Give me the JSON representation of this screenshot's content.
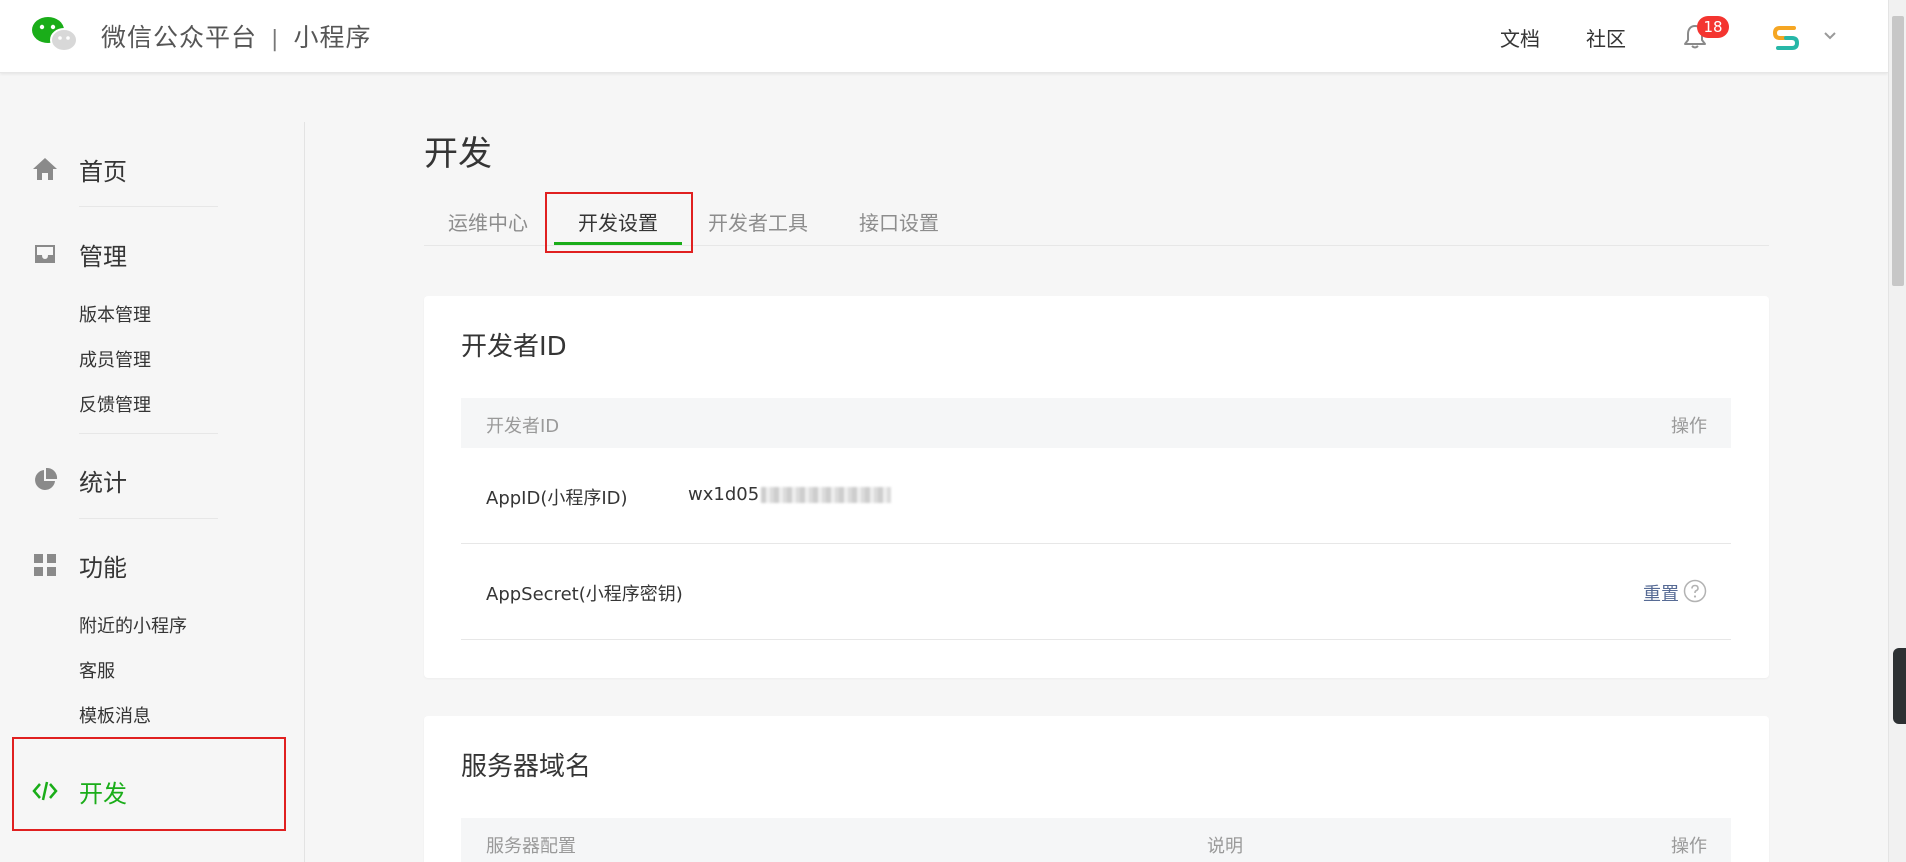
{
  "header": {
    "brand": "微信公众平台",
    "separator": "|",
    "product": "小程序",
    "docs_label": "文档",
    "community_label": "社区",
    "notification_count": "18"
  },
  "sidebar": {
    "home": "首页",
    "manage": "管理",
    "manage_items": [
      "版本管理",
      "成员管理",
      "反馈管理"
    ],
    "stats": "统计",
    "features": "功能",
    "feature_items": [
      "附近的小程序",
      "客服",
      "模板消息"
    ],
    "develop": "开发"
  },
  "main": {
    "title": "开发",
    "tabs": [
      "运维中心",
      "开发设置",
      "开发者工具",
      "接口设置"
    ],
    "active_tab": 1
  },
  "developer_id": {
    "title": "开发者ID",
    "col_id": "开发者ID",
    "col_action": "操作",
    "appid_label": "AppID(小程序ID)",
    "appid_value": "wx1d05",
    "secret_label": "AppSecret(小程序密钥)",
    "reset_label": "重置"
  },
  "server_domain": {
    "title": "服务器域名",
    "col_config": "服务器配置",
    "col_desc": "说明",
    "col_action": "操作"
  },
  "colors": {
    "accent": "#1aad19",
    "highlight": "#e02020",
    "link": "#576b95",
    "badge": "#f43530"
  }
}
